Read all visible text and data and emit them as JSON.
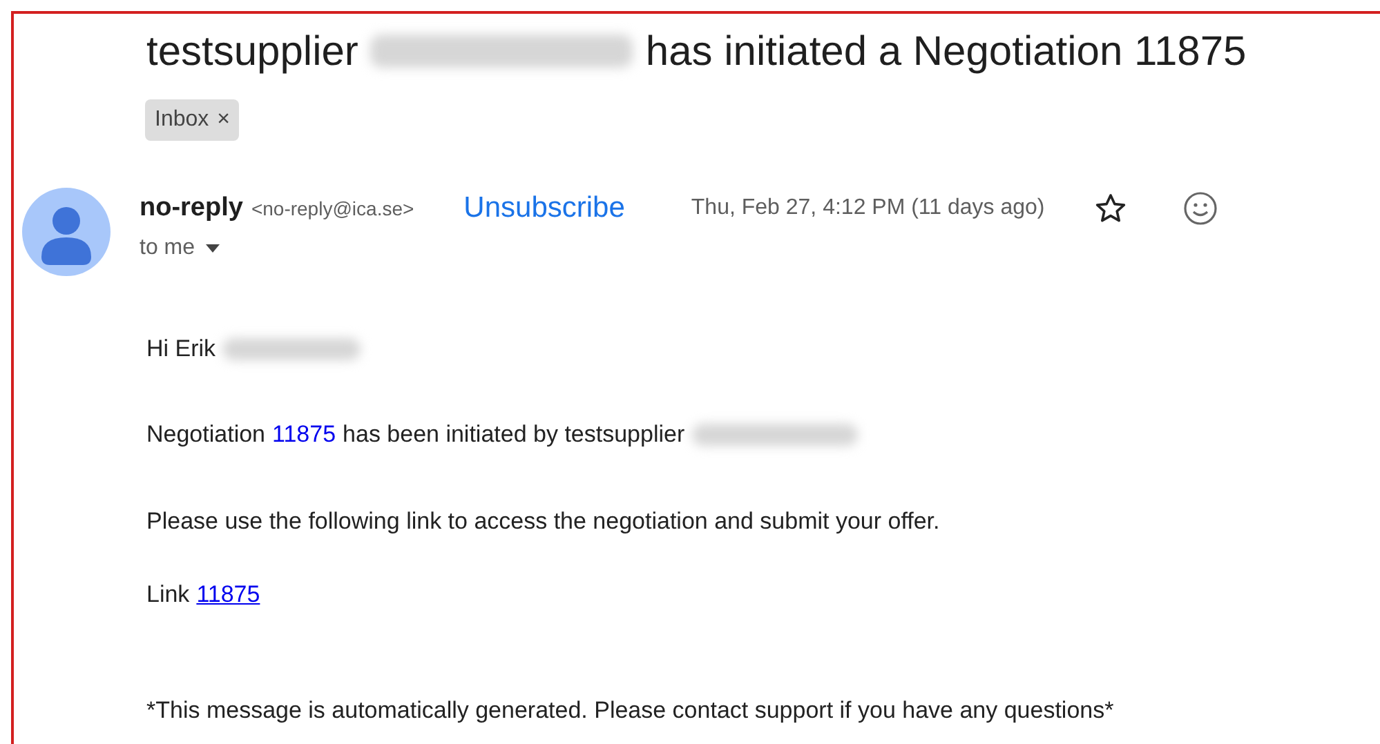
{
  "subject": [
    {
      "kind": "text",
      "text": "testsupplier"
    },
    {
      "kind": "redacted"
    },
    {
      "kind": "text",
      "text": "has initiated a Negotiation 11875"
    }
  ],
  "labels": [
    {
      "text": "Inbox",
      "remove": "×"
    }
  ],
  "sender": {
    "name": "no-reply",
    "address": "<no-reply@ica.se>",
    "unsubscribe": "Unsubscribe",
    "date": "Thu, Feb 27, 4:12 PM (11 days ago)",
    "starred": false,
    "recipient": "to me"
  },
  "body": [
    [
      {
        "kind": "text",
        "text": "Hi Erik"
      },
      {
        "kind": "redacted"
      }
    ],
    [
      {
        "kind": "text",
        "text": "Negotiation"
      },
      {
        "kind": "link",
        "text": "11875",
        "underlined": false
      },
      {
        "kind": "text",
        "text": "has been initiated by testsupplier"
      },
      {
        "kind": "redacted"
      }
    ],
    [
      {
        "kind": "text",
        "text": "Please use the following link to access the negotiation and submit your offer."
      }
    ],
    [
      {
        "kind": "text",
        "text": "Link"
      },
      {
        "kind": "link",
        "text": "11875",
        "underlined": true
      }
    ],
    [
      {
        "kind": "text",
        "text": "*This message is automatically generated. Please contact support if you have any questions*"
      }
    ]
  ]
}
